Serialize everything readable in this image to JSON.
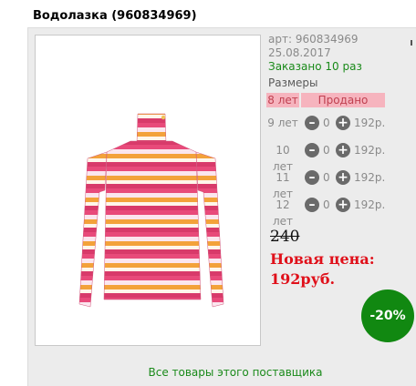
{
  "product": {
    "title": "Водолазка (960834969)",
    "article": "арт: 960834969",
    "date": "25.08.2017",
    "ordered": "Заказано 10 раз"
  },
  "sizes": {
    "title": "Размеры",
    "sold_row": {
      "label": "8 лет",
      "status": "Продано"
    },
    "rows": [
      {
        "label": "9 лет",
        "qty": "0",
        "price": "192р."
      },
      {
        "label": "10 лет",
        "qty": "0",
        "price": "192р."
      },
      {
        "label": "11 лет",
        "qty": "0",
        "price": "192р."
      },
      {
        "label": "12 лет",
        "qty": "0",
        "price": "192р."
      }
    ]
  },
  "pricing": {
    "old_price": "240",
    "new_price_line1": "Новая цена:",
    "new_price_line2": "192руб.",
    "discount": "-20%"
  },
  "footer": {
    "supplier_link": "Все товары этого поставщика"
  },
  "colors": {
    "accent_red": "#e0101a",
    "accent_green": "#118811",
    "sold_bg": "#f6b4be"
  }
}
